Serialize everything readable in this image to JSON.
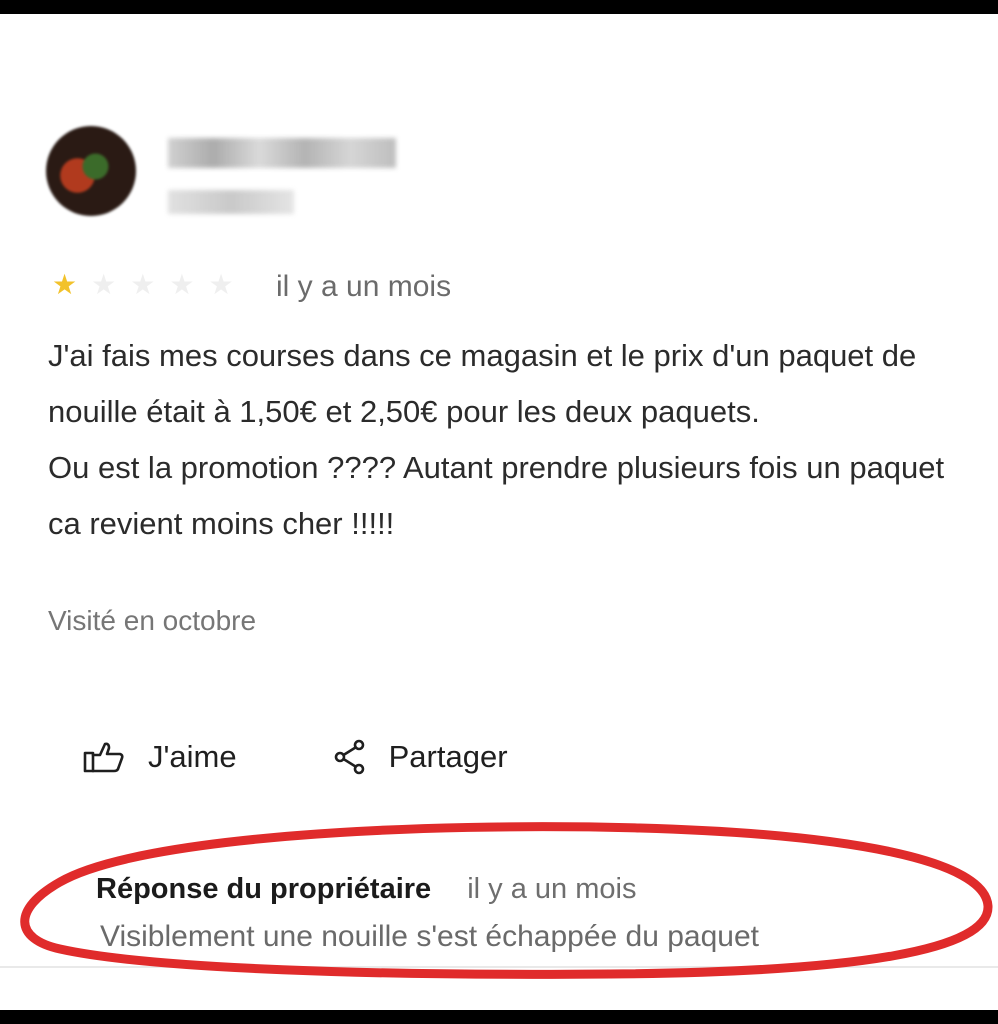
{
  "review": {
    "rating": 1,
    "max_rating": 5,
    "time_ago": "il y a un mois",
    "paragraphs": [
      "J'ai fais mes courses dans ce magasin et le prix d'un paquet de nouille était à 1,50€ et 2,50€ pour les deux paquets.",
      "Ou est la promotion ???? Autant prendre plusieurs fois un paquet ca revient moins cher !!!!!"
    ],
    "visited": "Visité en octobre"
  },
  "actions": {
    "like_label": "J'aime",
    "share_label": "Partager"
  },
  "owner_reply": {
    "title": "Réponse du propriétaire",
    "time_ago": "il y a un mois",
    "text": "Visiblement une nouille s'est échappée du paquet"
  },
  "colors": {
    "star_filled": "#f2c22b",
    "star_empty": "#efefef",
    "highlight": "#e02b2b"
  },
  "icons": {
    "like": "thumbs-up-icon",
    "share": "share-icon"
  }
}
